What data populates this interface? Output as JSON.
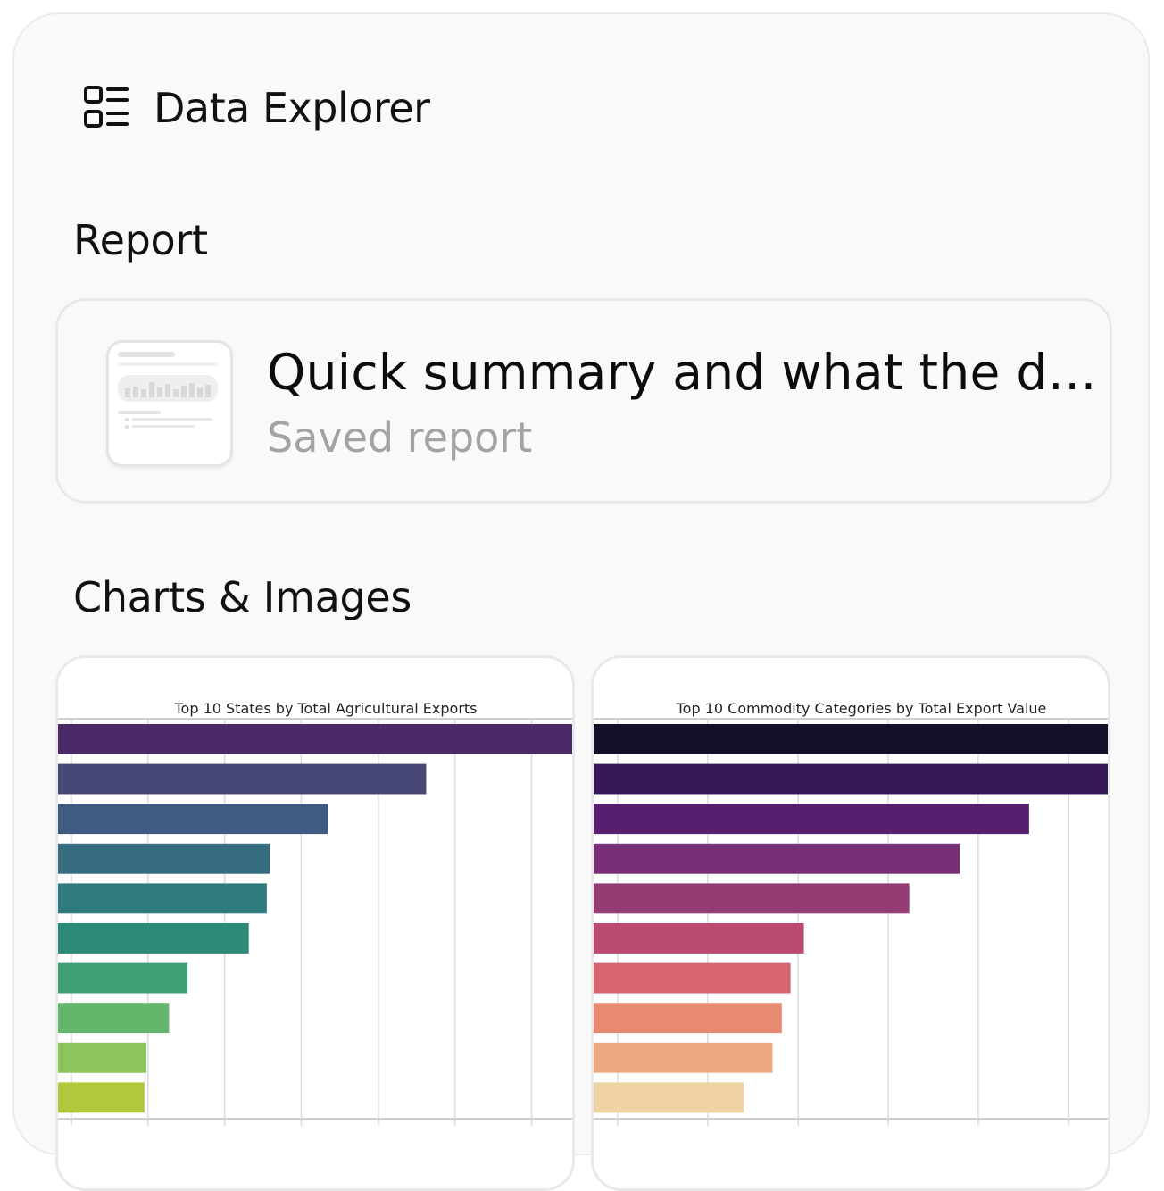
{
  "header": {
    "title": "Data Explorer",
    "icon": "list-layout-icon"
  },
  "sections": {
    "report_heading": "Report",
    "charts_heading": "Charts & Images"
  },
  "report": {
    "title": "Quick summary and what the d…",
    "subtitle": "Saved report",
    "thumbnail_icon": "report-thumbnail-icon"
  },
  "chart_data": [
    {
      "type": "bar",
      "orientation": "horizontal",
      "title": "Top 10 States by Total Agricultural Exports",
      "xlabel": "",
      "ylabel": "",
      "values": [
        100,
        71.6,
        52.5,
        41.2,
        40.6,
        37.1,
        25.2,
        21.6,
        17.2,
        16.8
      ],
      "colors": [
        "#4a2a67",
        "#474778",
        "#3f5b82",
        "#366c80",
        "#2f7a7d",
        "#2b8b78",
        "#3ea077",
        "#64b66c",
        "#8cc45d",
        "#b0c83b"
      ],
      "grid": true
    },
    {
      "type": "bar",
      "orientation": "horizontal",
      "title": "Top 10 Commodity Categories by Total Export Value",
      "xlabel": "",
      "ylabel": "",
      "values": [
        100,
        100,
        84.7,
        71.2,
        61.4,
        40.9,
        38.3,
        36.6,
        34.8,
        29.2
      ],
      "colors": [
        "#140f2b",
        "#361957",
        "#591f6f",
        "#762e74",
        "#963c75",
        "#bc4b73",
        "#d7646f",
        "#e78a6f",
        "#edaa82",
        "#f0d3a2"
      ],
      "grid": true
    }
  ]
}
